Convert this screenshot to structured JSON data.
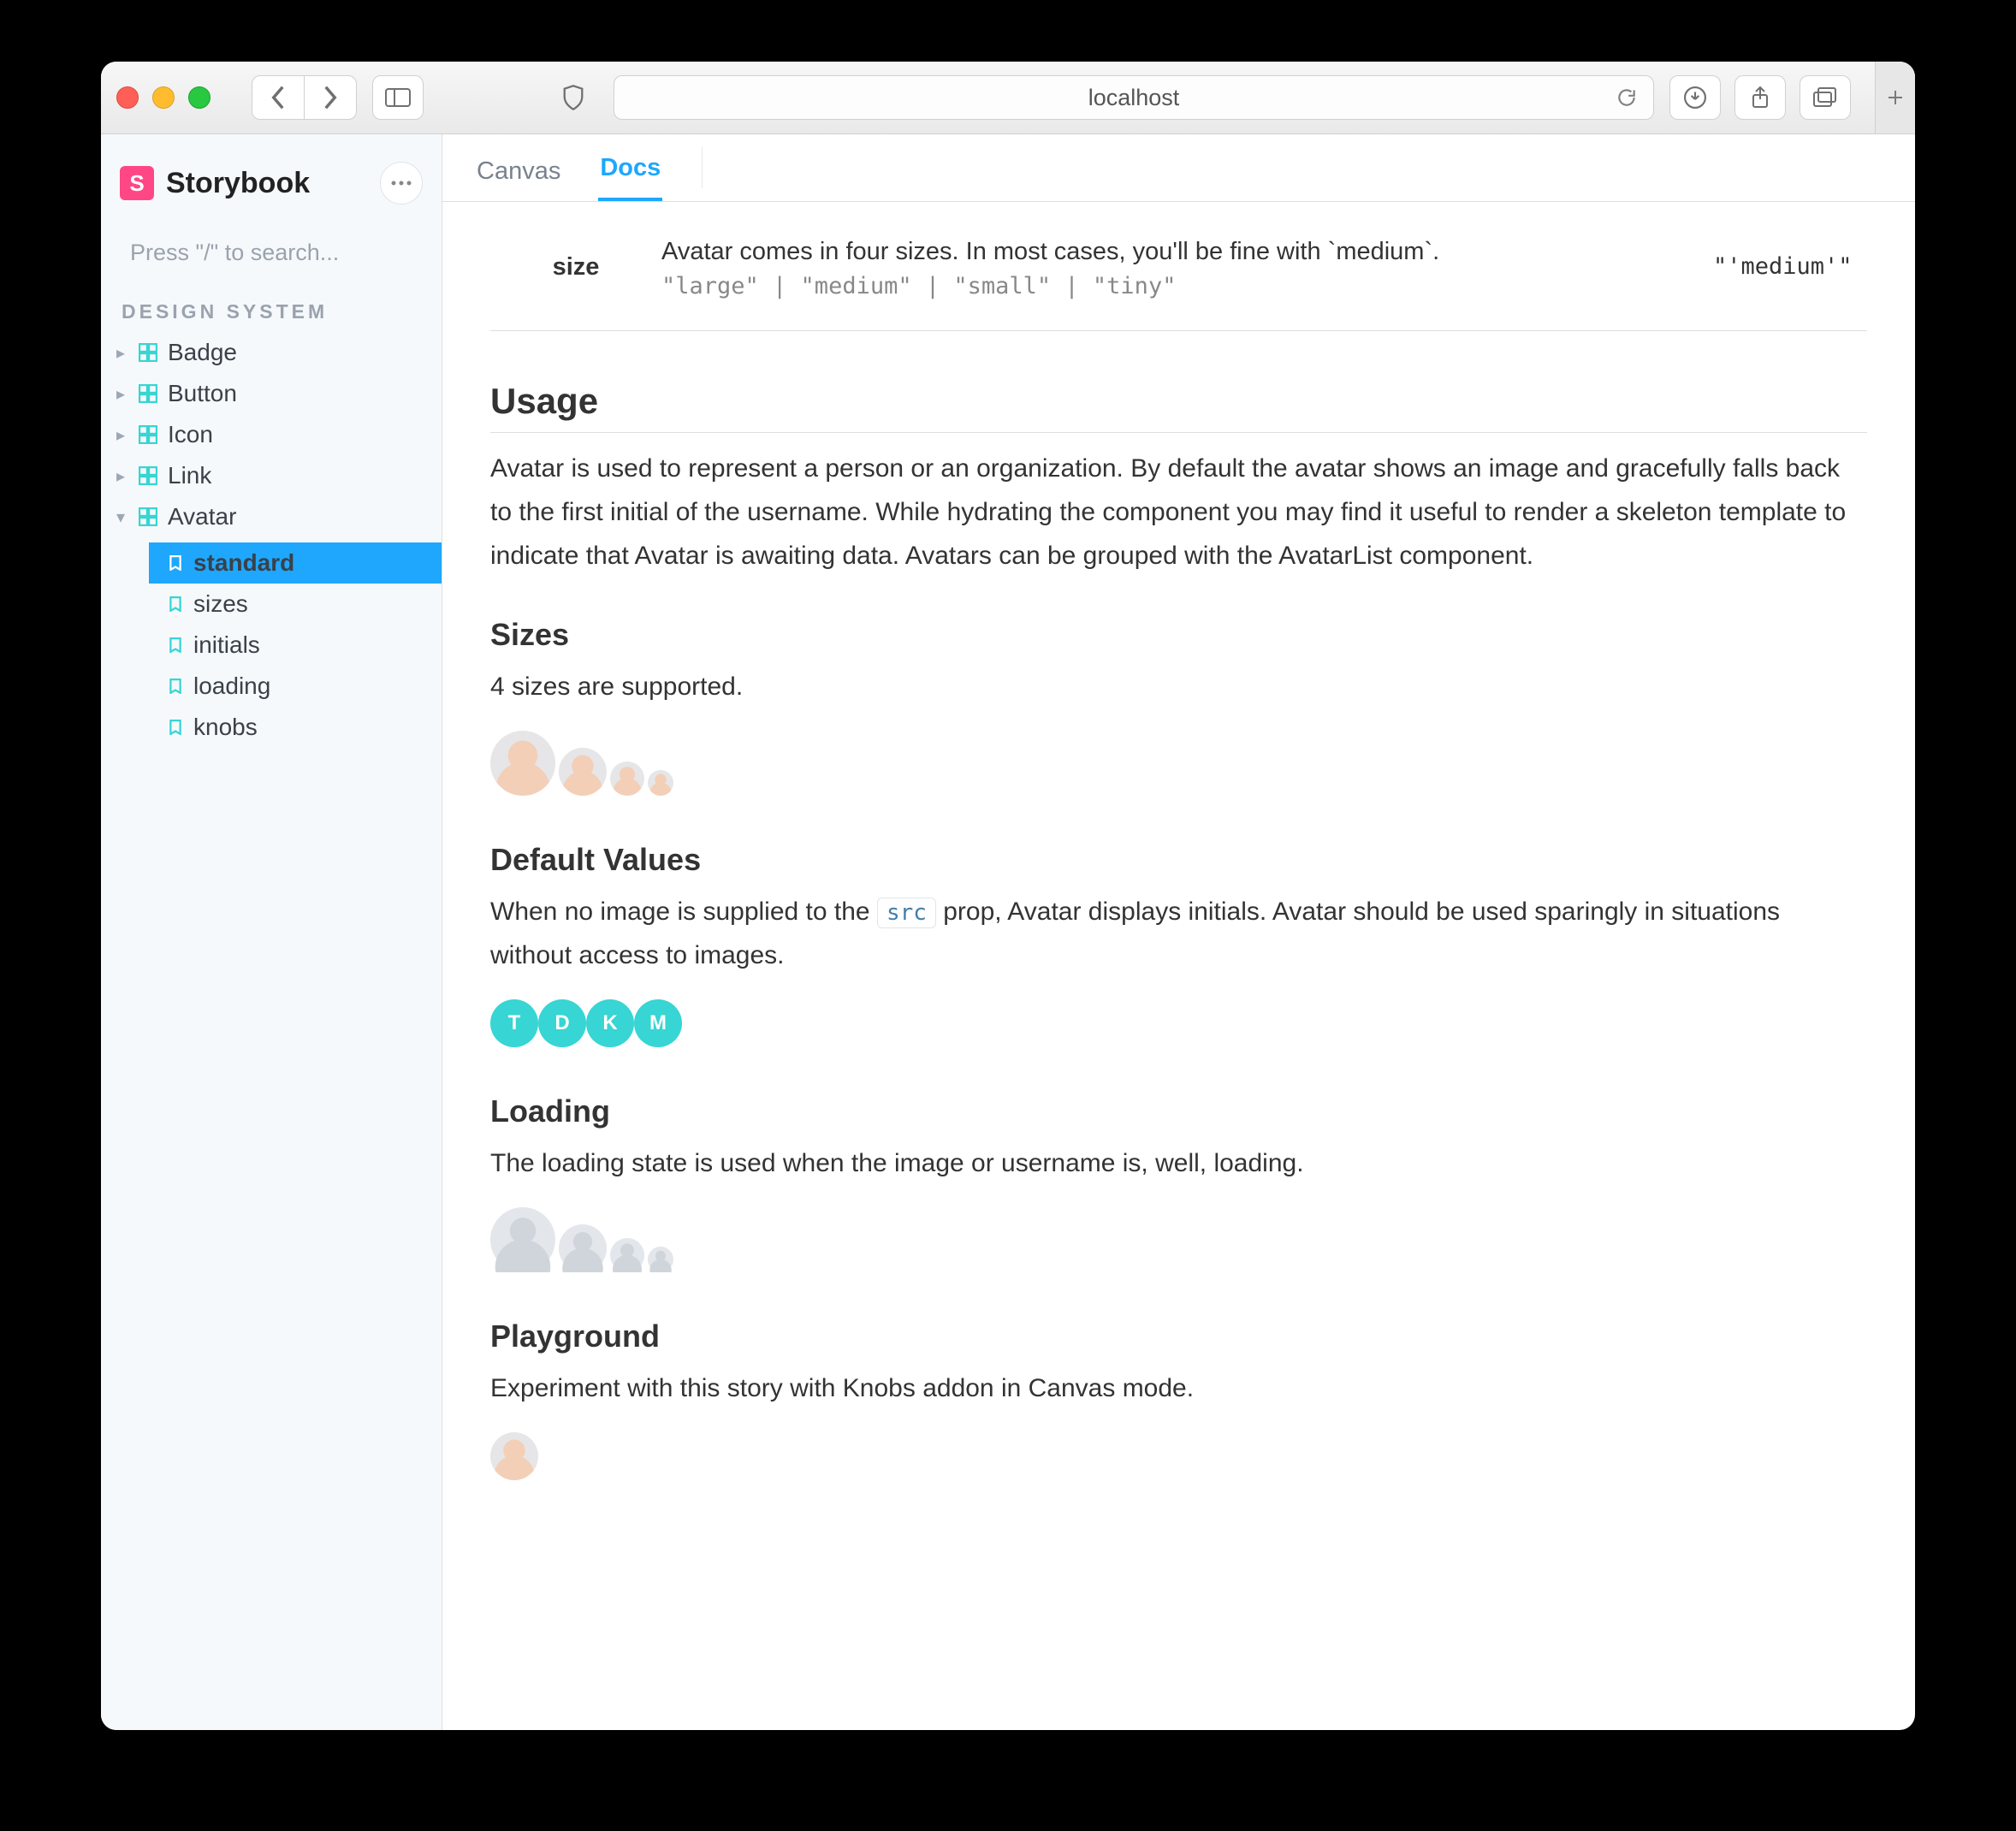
{
  "browser": {
    "url": "localhost"
  },
  "app": {
    "brand": "Storybook",
    "search_placeholder": "Press \"/\" to search..."
  },
  "sidebar": {
    "section": "DESIGN SYSTEM",
    "items": [
      {
        "label": "Badge",
        "expanded": false
      },
      {
        "label": "Button",
        "expanded": false
      },
      {
        "label": "Icon",
        "expanded": false
      },
      {
        "label": "Link",
        "expanded": false
      },
      {
        "label": "Avatar",
        "expanded": true,
        "children": [
          {
            "label": "standard",
            "active": true
          },
          {
            "label": "sizes"
          },
          {
            "label": "initials"
          },
          {
            "label": "loading"
          },
          {
            "label": "knobs"
          }
        ]
      }
    ]
  },
  "tabs": [
    {
      "label": "Canvas",
      "active": false
    },
    {
      "label": "Docs",
      "active": true
    }
  ],
  "props": {
    "size": {
      "name": "size",
      "desc": "Avatar comes in four sizes. In most cases, you'll be fine with `medium`.",
      "type": "\"large\" | \"medium\" | \"small\" | \"tiny\"",
      "default": "\"'medium'\""
    }
  },
  "doc": {
    "usage_h": "Usage",
    "usage_p": "Avatar is used to represent a person or an organization. By default the avatar shows an image and gracefully falls back to the first initial of the username. While hydrating the component you may find it useful to render a skeleton template to indicate that Avatar is awaiting data. Avatars can be grouped with the AvatarList component.",
    "sizes_h": "Sizes",
    "sizes_p": "4 sizes are supported.",
    "defaults_h": "Default Values",
    "defaults_pre": "When no image is supplied to the ",
    "defaults_code": "src",
    "defaults_post": " prop, Avatar displays initials. Avatar should be used sparingly in situations without access to images.",
    "defaults_initials": [
      "T",
      "D",
      "K",
      "M"
    ],
    "loading_h": "Loading",
    "loading_p": "The loading state is used when the image or username is, well, loading.",
    "playground_h": "Playground",
    "playground_p": "Experiment with this story with Knobs addon in Canvas mode."
  }
}
